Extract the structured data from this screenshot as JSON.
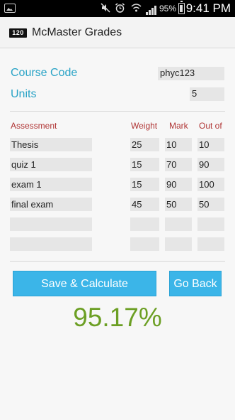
{
  "status_bar": {
    "battery": "95%",
    "time": "9:41 PM",
    "icons": [
      "picture-icon",
      "mute-icon",
      "alarm-icon",
      "wifi-icon",
      "signal-icon",
      "battery-icon"
    ]
  },
  "app": {
    "logo_text": "120",
    "title": "McMaster Grades"
  },
  "course": {
    "code_label": "Course Code",
    "code_value": "phyc123",
    "units_label": "Units",
    "units_value": "5"
  },
  "table": {
    "headers": [
      "Assessment",
      "Weight",
      "Mark",
      "Out of"
    ],
    "rows": [
      {
        "assessment": "Thesis",
        "weight": "25",
        "mark": "10",
        "out_of": "10"
      },
      {
        "assessment": "quiz 1",
        "weight": "15",
        "mark": "70",
        "out_of": "90"
      },
      {
        "assessment": "exam 1",
        "weight": "15",
        "mark": "90",
        "out_of": "100"
      },
      {
        "assessment": "final exam",
        "weight": "45",
        "mark": "50",
        "out_of": "50"
      },
      {
        "assessment": "",
        "weight": "",
        "mark": "",
        "out_of": ""
      },
      {
        "assessment": "",
        "weight": "",
        "mark": "",
        "out_of": ""
      }
    ]
  },
  "buttons": {
    "save_calculate": "Save & Calculate",
    "go_back": "Go Back"
  },
  "result": "95.17%",
  "colors": {
    "accent_blue": "#29a3c6",
    "button_blue": "#3bb5e8",
    "header_red": "#b03535",
    "result_green": "#6c9f24"
  }
}
